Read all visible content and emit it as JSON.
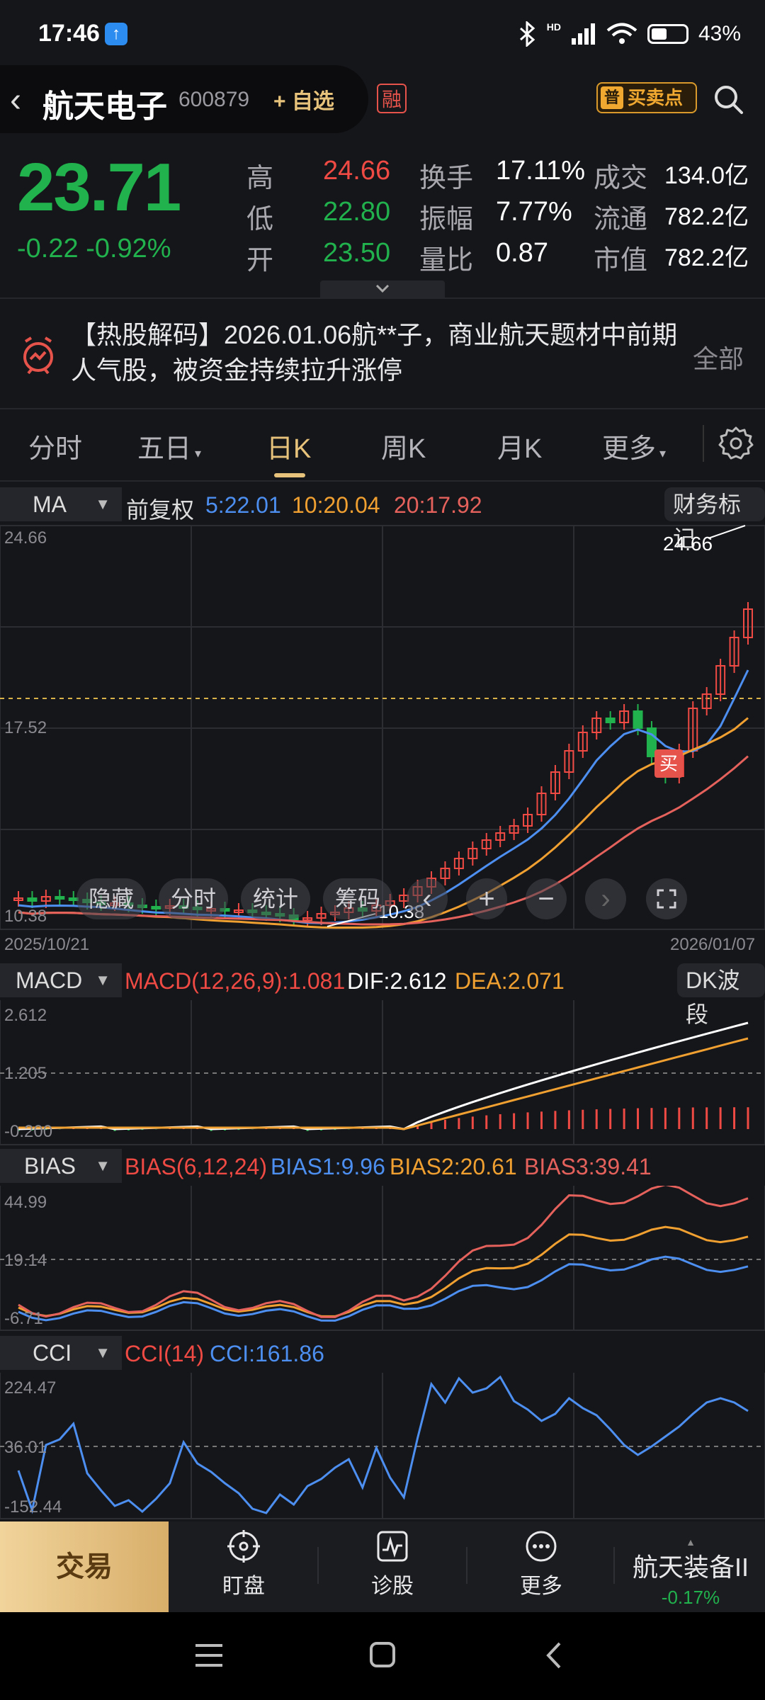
{
  "status_bar": {
    "time": "17:46",
    "upload_badge": "↑",
    "network": "HD",
    "battery": "43%",
    "battery_level": 0.43
  },
  "header": {
    "stock_name": "航天电子",
    "stock_code": "600879",
    "add_watchlist": "+ 自选",
    "margin_badge": "融",
    "buy_sell_badge_icon": "普",
    "buy_sell_points": "买卖点"
  },
  "quote": {
    "price": "23.71",
    "change": "-0.22",
    "change_pct": "-0.92%",
    "stats": [
      {
        "label": "高",
        "value": "24.66",
        "color": "red"
      },
      {
        "label": "低",
        "value": "22.80",
        "color": "green"
      },
      {
        "label": "开",
        "value": "23.50",
        "color": "green"
      },
      {
        "label": "换手",
        "value": "17.11%",
        "color": "white"
      },
      {
        "label": "振幅",
        "value": "7.77%",
        "color": "white"
      },
      {
        "label": "量比",
        "value": "0.87",
        "color": "white"
      },
      {
        "label": "成交",
        "value": "134.0亿",
        "color": "white"
      },
      {
        "label": "流通",
        "value": "782.2亿",
        "color": "white"
      },
      {
        "label": "市值",
        "value": "782.2亿",
        "color": "white"
      }
    ]
  },
  "news": {
    "text": "【热股解码】2026.01.06航**子，商业航天题材中前期人气股，被资金持续拉升涨停",
    "all_label": "全部"
  },
  "tabs": [
    {
      "label": "分时",
      "active": false
    },
    {
      "label": "五日",
      "active": false,
      "dropdown": true
    },
    {
      "label": "日K",
      "active": true
    },
    {
      "label": "周K",
      "active": false
    },
    {
      "label": "月K",
      "active": false
    },
    {
      "label": "更多",
      "active": false,
      "dropdown": true
    }
  ],
  "kline": {
    "indicator_select": "MA",
    "adjust": "前复权",
    "ma5": "5:22.01",
    "ma10": "10:20.04",
    "ma20": "20:17.92",
    "finance_mark": "财务标记",
    "y_high": "24.66",
    "y_mid": "17.52",
    "y_low": "10.38",
    "high_marker": "24.66",
    "low_marker": "10.38",
    "date_start": "2025/10/21",
    "date_end": "2026/01/07",
    "buy_marker": "买",
    "overlay_buttons": [
      "隐藏",
      "分时",
      "统计",
      "筹码"
    ],
    "colors": {
      "up": "#ef4a43",
      "down": "#21b14d",
      "ma5": "#4d8ff0",
      "ma10": "#f0a030",
      "ma20": "#e5625c"
    }
  },
  "macd": {
    "select": "MACD",
    "params": "MACD(12,26,9):1.081",
    "dif": "DIF:2.612",
    "dea": "DEA:2.071",
    "dk_band": "DK波段",
    "y_high": "2.612",
    "y_mid": "1.205",
    "y_low": "-0.200"
  },
  "bias": {
    "select": "BIAS",
    "params": "BIAS(6,12,24)",
    "bias1": "BIAS1:9.96",
    "bias2": "BIAS2:20.61",
    "bias3": "BIAS3:39.41",
    "y_high": "44.99",
    "y_mid": "19.14",
    "y_low": "-6.71"
  },
  "cci": {
    "select": "CCI",
    "params": "CCI(14)",
    "value": "CCI:161.86",
    "y_high": "224.47",
    "y_mid": "36.01",
    "y_low": "-152.44"
  },
  "bottom_nav": {
    "trade": "交易",
    "items": [
      {
        "label": "盯盘",
        "icon": "target-icon"
      },
      {
        "label": "诊股",
        "icon": "diagnosis-icon"
      },
      {
        "label": "更多",
        "icon": "more-dots-icon"
      }
    ],
    "sector_name": "航天装备II",
    "sector_change": "-0.17%"
  }
}
